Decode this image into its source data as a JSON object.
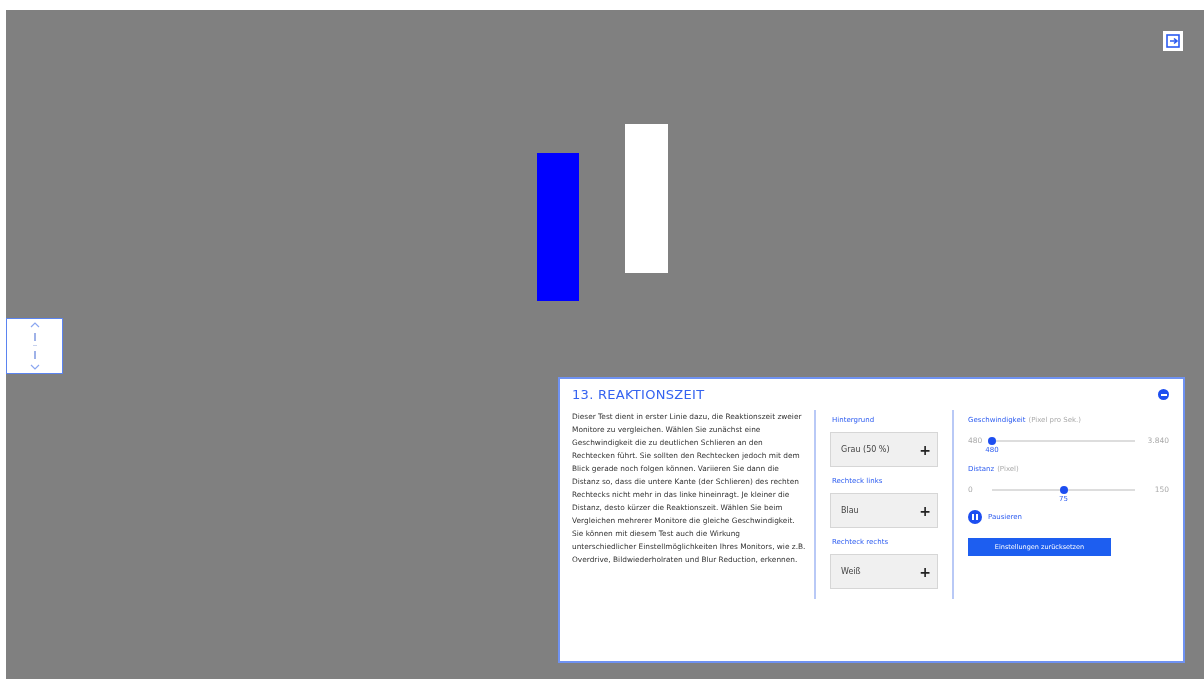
{
  "rectangles": [
    {
      "kind": "left",
      "color": "#0000ff"
    },
    {
      "kind": "right",
      "color": "#ffffff"
    }
  ],
  "panel": {
    "title": "13. REAKTIONSZEIT",
    "description": [
      "Dieser Test dient in erster Linie dazu, die Reaktionszeit zweier Monitore zu vergleichen. Wählen Sie zunächst eine Geschwindigkeit die zu deutlichen Schlieren an den Rechtecken führt. Sie sollten den Rechtecken jedoch mit dem Blick gerade noch folgen können. Variieren Sie dann die Distanz so, dass die untere Kante (der Schlieren) des rechten Rechtecks nicht mehr in das linke hineinragt. Je kleiner die Distanz, desto kürzer die Reaktionszeit. Wählen Sie beim Vergleichen mehrerer Monitore die gleiche Geschwindigkeit.",
      "Sie können mit diesem Test auch die Wirkung unterschiedlicher Einstellmöglichkeiten Ihres Monitors, wie z.B. Overdrive, Bildwiederholraten und Blur Reduction, erkennen."
    ],
    "selects": [
      {
        "label": "Hintergrund",
        "value": "Grau (50 %)",
        "button": "+"
      },
      {
        "label": "Rechteck links",
        "value": "Blau",
        "button": "+"
      },
      {
        "label": "Rechteck rechts",
        "value": "Weiß",
        "button": "+"
      }
    ],
    "sliders": [
      {
        "label": "Geschwindigkeit",
        "unit": "(Pixel pro Sek.)",
        "min": "480",
        "max": "3.840",
        "reading": "480",
        "level": 0
      },
      {
        "label": "Distanz",
        "unit": "(Pixel)",
        "min": "0",
        "max": "150",
        "reading": "75",
        "level": 0.5
      }
    ],
    "pause_button": "Pausieren",
    "reset_button": "Einstellungen zurücksetzen"
  }
}
